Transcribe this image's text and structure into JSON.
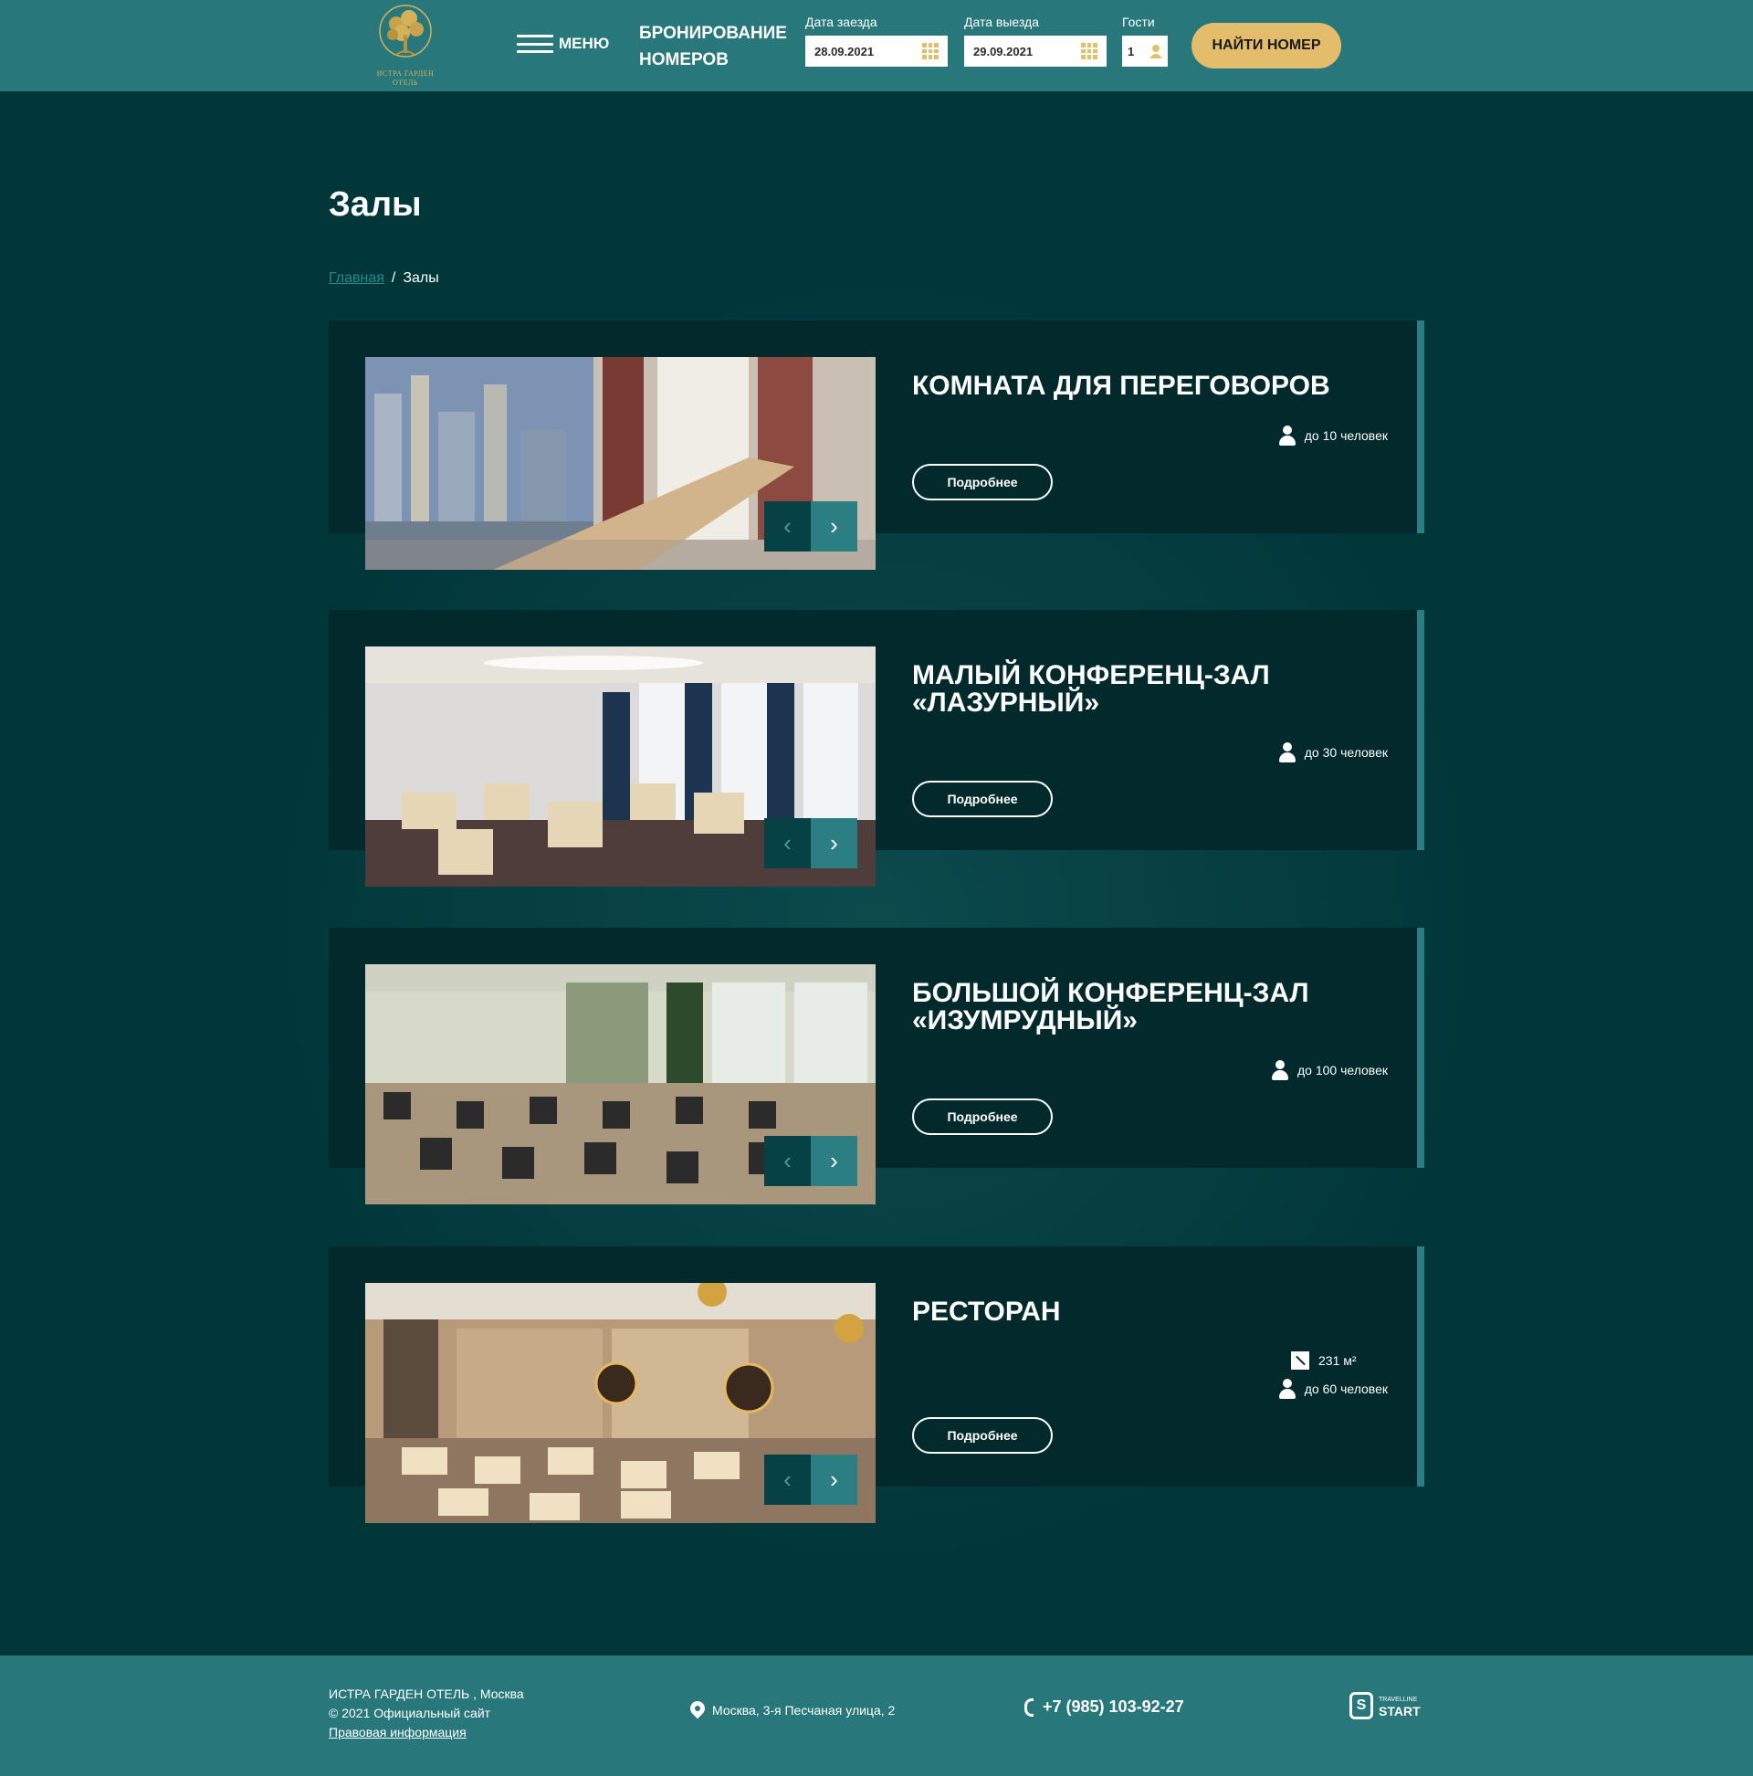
{
  "header": {
    "logo_text_line1": "ИСТРА ГАРДЕН",
    "logo_text_line2": "ОТЕЛЬ",
    "menu_label": "МЕНЮ",
    "booking_title": "БРОНИРОВАНИЕ НОМЕРОВ",
    "checkin_label": "Дата заезда",
    "checkin_value": "28.09.2021",
    "checkout_label": "Дата выезда",
    "checkout_value": "29.09.2021",
    "guests_label": "Гости",
    "guests_value": "1",
    "find_button": "НАЙТИ НОМЕР"
  },
  "page": {
    "title": "Залы",
    "breadcrumb": {
      "home": "Главная",
      "separator": "/",
      "current": "Залы"
    }
  },
  "halls": [
    {
      "title": "КОМНАТА ДЛЯ ПЕРЕГОВОРОВ",
      "capacity": "до 10  человек",
      "details": "Подробнее"
    },
    {
      "title": "МАЛЫЙ КОНФЕРЕНЦ-ЗАЛ «ЛАЗУРНЫЙ»",
      "capacity": "до 30  человек",
      "details": "Подробнее"
    },
    {
      "title": "БОЛЬШОЙ КОНФЕРЕНЦ-ЗАЛ «ИЗУМРУДНЫЙ»",
      "capacity": "до 100  человек",
      "details": "Подробнее"
    },
    {
      "title": "РЕСТОРАН",
      "area": "231 м²",
      "capacity": "до 60  человек",
      "details": "Подробнее"
    }
  ],
  "footer": {
    "hotel_name": " ИСТРА ГАРДЕН ОТЕЛЬ , Москва",
    "copyright": "© 2021 Официальный сайт",
    "legal_link": "Правовая информация",
    "address": "Москва, 3-я Песчаная улица, 2",
    "phone": "+7 (985) 103-92-27",
    "brand_small": "TRAVELLINE",
    "brand_big": "START"
  },
  "colors": {
    "header_bg": "#28777a",
    "page_bg": "#02373a",
    "card_bg": "#022a2c",
    "accent_gold": "#e3bd6c"
  },
  "icons": [
    "burger-menu-icon",
    "calendar-icon",
    "guest-icon",
    "person-icon",
    "area-icon",
    "chevron-left-icon",
    "chevron-right-icon",
    "map-pin-icon",
    "phone-icon"
  ]
}
